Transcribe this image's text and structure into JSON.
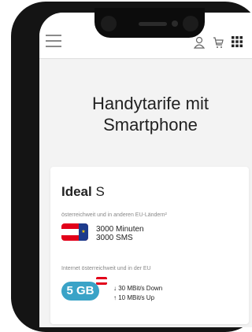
{
  "header": {
    "menu_icon": "hamburger-icon",
    "user_icon": "user-icon",
    "cart_icon": "cart-icon",
    "apps_icon": "grid-icon"
  },
  "hero": {
    "line1": "Handytarife mit",
    "line2": "Smartphone"
  },
  "tariff": {
    "name_bold": "Ideal",
    "name_suffix": "S",
    "coverage_text": "österreichweit und in anderen EU-Ländern²",
    "minutes": "3000 Minuten",
    "sms": "3000 SMS",
    "internet_text": "Internet österreichweit und in der EU",
    "data_volume": "5 GB",
    "down_speed": "30 MBit/s Down",
    "up_speed": "10 MBit/s Up"
  },
  "colors": {
    "accent_blue": "#3aa3c7",
    "flag_red": "#e2001a",
    "eu_blue": "#1d3b8c"
  }
}
